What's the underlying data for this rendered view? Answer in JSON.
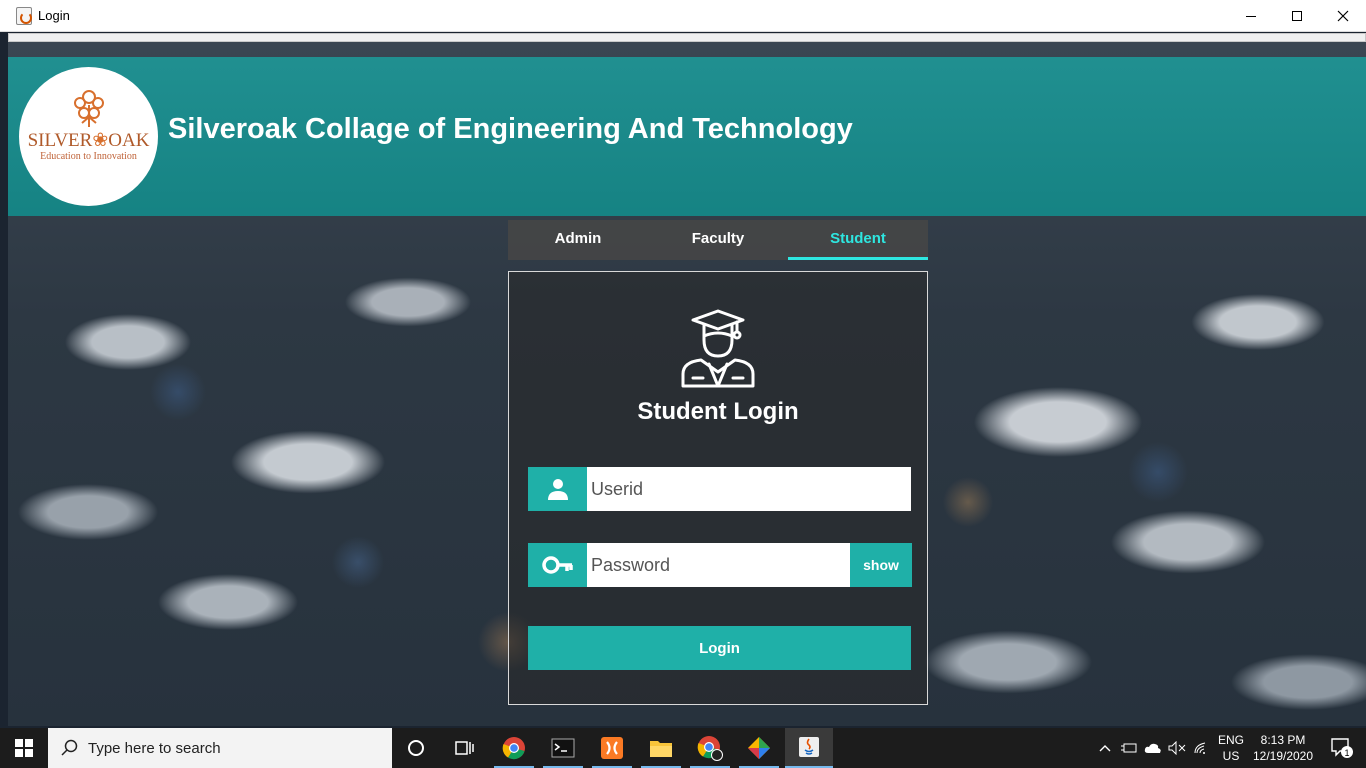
{
  "window": {
    "title": "Login"
  },
  "header": {
    "logo_name_left": "SILVER",
    "logo_name_right": "OAK",
    "logo_tagline": "Education to Innovation",
    "college_title": "Silveroak Collage of Engineering And Technology"
  },
  "tabs": [
    {
      "label": "Admin",
      "active": false
    },
    {
      "label": "Faculty",
      "active": false
    },
    {
      "label": "Student",
      "active": true
    }
  ],
  "login": {
    "title": "Student Login",
    "userid_placeholder": "Userid",
    "password_placeholder": "Password",
    "show_label": "show",
    "login_label": "Login"
  },
  "taskbar": {
    "search_placeholder": "Type here to search",
    "lang_top": "ENG",
    "lang_bottom": "US",
    "time": "8:13 PM",
    "date": "12/19/2020",
    "notification_count": "1",
    "pinned": [
      "chrome-icon",
      "terminal-icon",
      "xampp-icon",
      "file-explorer-icon",
      "chrome-profile-icon",
      "git-icon",
      "java-icon"
    ]
  },
  "colors": {
    "accent": "#1fb0a8",
    "tab_active": "#2ee6e0",
    "header_band": "#1e9696"
  }
}
